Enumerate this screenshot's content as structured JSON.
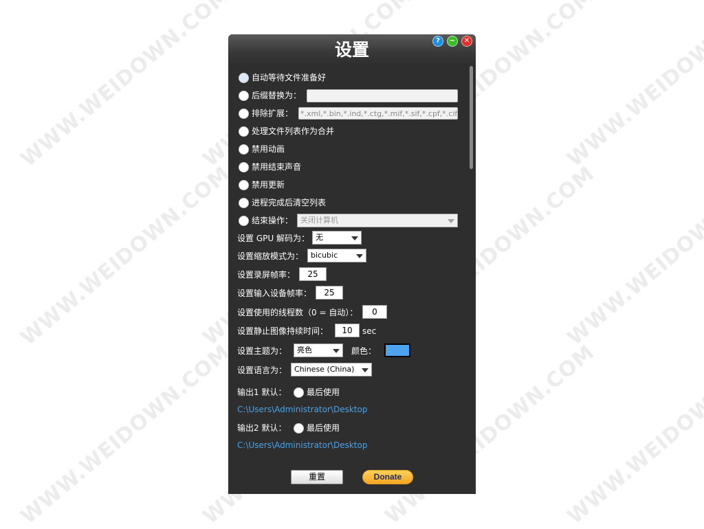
{
  "window": {
    "title": "设置",
    "help_glyph": "?",
    "minimize_glyph": "−",
    "close_glyph": "✕"
  },
  "options": {
    "auto_wait": "自动等待文件准备好",
    "suffix_replace": "后缀替换为：",
    "suffix_value": "",
    "exclude_ext": "排除扩展：",
    "exclude_value": "*.xml,*.bin,*.ind,*.ctg,*.mif,*.sif,*.cpf,*.cif,*.b",
    "merge_list": "处理文件列表作为合并",
    "disable_animation": "禁用动画",
    "disable_end_sound": "禁用结束声音",
    "disable_update": "禁用更新",
    "clear_list": "进程完成后清空列表",
    "end_action": "结束操作：",
    "end_action_value": "关闭计算机"
  },
  "settings": {
    "gpu_label": "设置 GPU 解码为：",
    "gpu_value": "无",
    "scale_label": "设置缩放模式为：",
    "scale_value": "bicubic",
    "record_fps_label": "设置录屏帧率：",
    "record_fps_value": "25",
    "input_fps_label": "设置输入设备帧率：",
    "input_fps_value": "25",
    "threads_label": "设置使用的线程数（0 = 自动）：",
    "threads_value": "0",
    "still_label": "设置静止图像持续时间：",
    "still_value": "10",
    "still_unit": "sec",
    "theme_label": "设置主题为：",
    "theme_value": "亮色",
    "color_label": "颜色：",
    "theme_color": "#4da3ee",
    "lang_label": "设置语言为：",
    "lang_value": "Chinese (China)"
  },
  "output": {
    "out1_label": "输出1 默认：",
    "out1_last": "最后使用",
    "out1_path": "C:\\Users\\Administrator\\Desktop",
    "out2_label": "输出2 默认：",
    "out2_last": "最后使用",
    "out2_path": "C:\\Users\\Administrator\\Desktop"
  },
  "buttons": {
    "reset": "重置",
    "donate": "Donate"
  },
  "watermark": "WWW.WEIDOWN.COM"
}
